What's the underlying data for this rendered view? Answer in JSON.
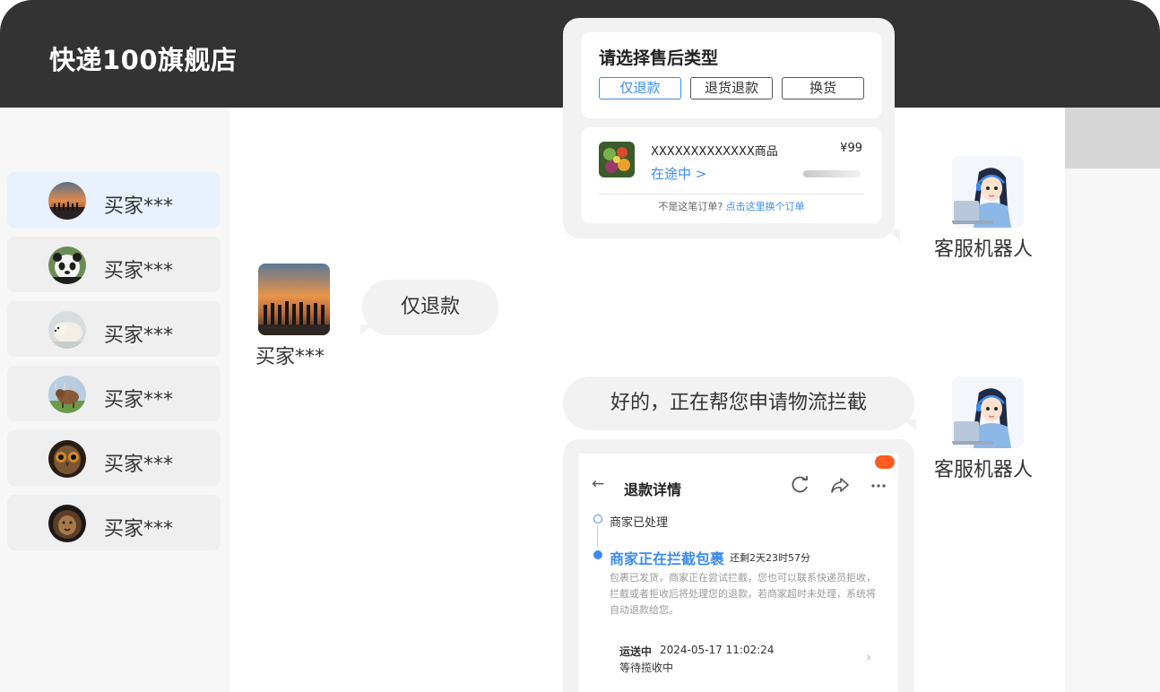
{
  "store": {
    "title": "快递100旗舰店"
  },
  "sidebar": {
    "contacts": [
      {
        "name": "买家***",
        "avatar": "sunset-group-avatar",
        "active": true
      },
      {
        "name": "买家***",
        "avatar": "panda-avatar",
        "active": false
      },
      {
        "name": "买家***",
        "avatar": "polar-bear-avatar",
        "active": false
      },
      {
        "name": "买家***",
        "avatar": "yak-avatar",
        "active": false
      },
      {
        "name": "买家***",
        "avatar": "owl-avatar",
        "active": false
      },
      {
        "name": "买家***",
        "avatar": "lion-avatar",
        "active": false
      }
    ]
  },
  "chat": {
    "aftersale_card": {
      "title": "请选择售后类型",
      "options": [
        "仅退款",
        "退货退款",
        "换货"
      ],
      "selected_option": "仅退款",
      "product_name": "XXXXXXXXXXXXX商品",
      "price": "¥99",
      "status": "在途中 >",
      "hint": "不是这笔订单?",
      "hint_link": "点击这里换个订单"
    },
    "bot_name": "客服机器人",
    "buyer_name": "买家***",
    "buyer_message": "仅退款",
    "bot_reply": "好的，正在帮您申请物流拦截",
    "refund_card": {
      "title": "退款详情",
      "step1": "商家已处理",
      "step2": "商家正在拦截包裹",
      "step2_remaining": "还剩2天23时57分",
      "description": "包裹已发货，商家正在尝试拦截，您也可以联系快递员拒收，拦截或者拒收后将处理您的退款，若商家超时未处理，系统将自动退款给您。",
      "shipping_status": "运送中",
      "shipping_time": "2024-05-17 11:02:24",
      "shipping_note": "等待揽收中"
    }
  },
  "colors": {
    "topbar": "#333333",
    "accent": "#3b8cf0",
    "bubble": "#f2f2f2",
    "badge": "#ff5a1f"
  }
}
